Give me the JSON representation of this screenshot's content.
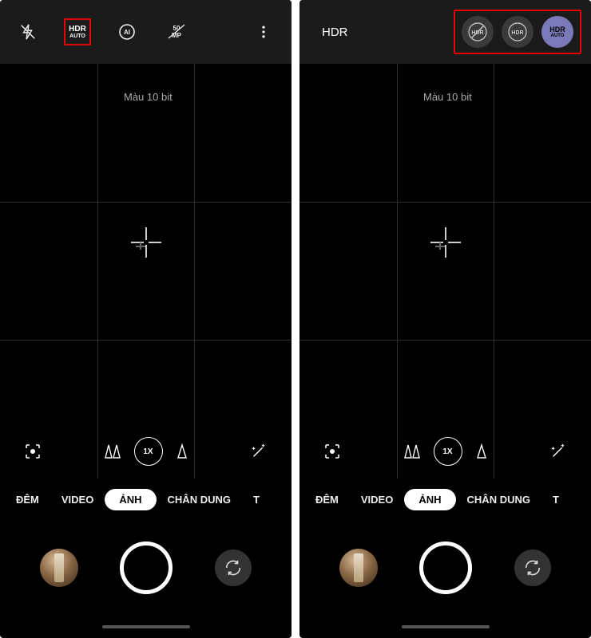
{
  "left": {
    "topbar": {
      "hdr_label": "HDR",
      "hdr_sub": "AUTO"
    },
    "viewfinder": {
      "bit_label": "Màu 10 bit",
      "zoom_value": "1X"
    },
    "modes": {
      "dem": "ĐÊM",
      "video": "VIDEO",
      "anh": "ẢNH",
      "chan_dung": "CHÂN DUNG",
      "cut": "T"
    }
  },
  "right": {
    "topbar": {
      "hdr_title": "HDR",
      "opt_off": "HDR",
      "opt_on": "HDR",
      "opt_auto": "HDR",
      "opt_auto_sub": "AUTO"
    },
    "viewfinder": {
      "bit_label": "Màu 10 bit",
      "zoom_value": "1X"
    },
    "modes": {
      "dem": "ĐÊM",
      "video": "VIDEO",
      "anh": "ẢNH",
      "chan_dung": "CHÂN DUNG",
      "cut": "T"
    }
  }
}
